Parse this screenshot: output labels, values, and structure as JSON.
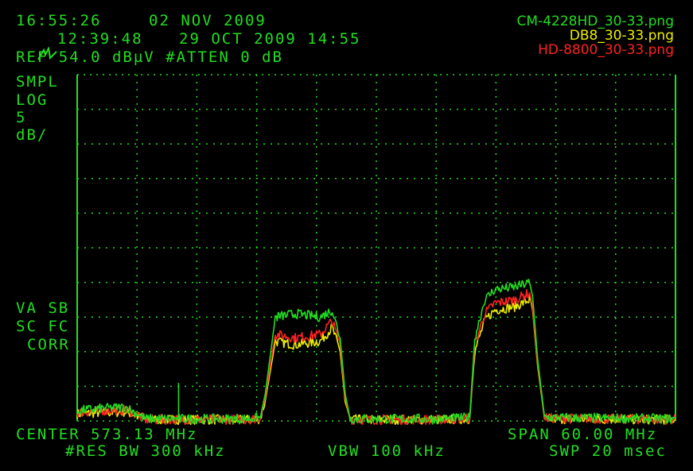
{
  "header": {
    "time": "16:55:26",
    "date": "02 NOV 2009",
    "saved_time": "12:39:48",
    "saved_date": "29 OCT 2009 14:55",
    "ref_line": "REF 54.0 dBµV #ATTEN 0 dB"
  },
  "left_labels": {
    "mode": "SMPL",
    "scale": "LOG",
    "div": "5",
    "unit": "dB/",
    "va_sb": "VA SB",
    "sc_fc": "SC FC",
    "corr": "CORR"
  },
  "footer": {
    "center": "CENTER 573.13 MHz",
    "span": "SPAN 60.00 MHz",
    "res_bw": "#RES BW 300 kHz",
    "vbw": "VBW 100 kHz",
    "swp": "SWP 20 msec"
  },
  "legend": [
    {
      "name": "CM-4228HD_30-33.png",
      "color": "#22dd22"
    },
    {
      "name": "DB8_30-33.png",
      "color": "#eeee00"
    },
    {
      "name": "HD-8800_30-33.png",
      "color": "#ff2222"
    }
  ],
  "chart_data": {
    "type": "line",
    "x_unit": "MHz",
    "y_unit": "dBµV",
    "xlim": [
      543.13,
      603.13
    ],
    "ylim": [
      4.0,
      54.0
    ],
    "grid": true,
    "series": [
      {
        "name": "CM-4228HD_30-33.png",
        "color": "#22dd22",
        "x": [
          543.13,
          545.5,
          548.0,
          549.0,
          550.0,
          560.0,
          561.5,
          562.0,
          563.0,
          565.0,
          567.5,
          568.7,
          569.5,
          570.0,
          570.5,
          580.0,
          582.5,
          583.0,
          584.0,
          585.0,
          587.0,
          588.5,
          588.8,
          589.3,
          590.0,
          603.13
        ],
        "y": [
          5.5,
          5.8,
          6.0,
          5.2,
          4.3,
          4.3,
          4.5,
          8.0,
          19.0,
          19.5,
          19.0,
          20.0,
          16.0,
          8.0,
          4.3,
          4.3,
          4.5,
          16.0,
          21.5,
          23.0,
          23.3,
          24.0,
          22.0,
          13.0,
          4.5,
          4.3
        ]
      },
      {
        "name": "DB8_30-33.png",
        "color": "#eeee00",
        "x": [
          543.13,
          545.5,
          548.0,
          549.0,
          550.0,
          560.0,
          561.5,
          562.0,
          563.0,
          565.0,
          567.5,
          568.7,
          569.5,
          570.0,
          570.5,
          580.0,
          582.5,
          583.0,
          584.0,
          585.0,
          587.0,
          588.5,
          588.8,
          589.3,
          590.0,
          603.13
        ],
        "y": [
          5.0,
          5.2,
          5.3,
          4.8,
          4.2,
          4.2,
          4.3,
          7.0,
          15.5,
          15.0,
          15.5,
          17.5,
          14.0,
          7.0,
          4.2,
          4.2,
          4.3,
          14.0,
          18.5,
          20.0,
          20.5,
          21.5,
          20.0,
          12.0,
          4.3,
          4.2
        ]
      },
      {
        "name": "HD-8800_30-33.png",
        "color": "#ff2222",
        "x": [
          543.13,
          545.5,
          548.0,
          549.0,
          550.0,
          560.0,
          561.5,
          562.0,
          563.0,
          565.0,
          567.5,
          568.7,
          569.5,
          570.0,
          570.5,
          580.0,
          582.5,
          583.0,
          584.0,
          585.0,
          587.0,
          588.5,
          588.8,
          589.3,
          590.0,
          603.13
        ],
        "y": [
          5.2,
          5.5,
          5.6,
          5.0,
          4.2,
          4.2,
          4.4,
          7.5,
          16.5,
          16.0,
          16.5,
          18.5,
          15.0,
          7.5,
          4.2,
          4.2,
          4.4,
          15.0,
          19.5,
          21.0,
          21.5,
          22.5,
          20.5,
          12.5,
          4.4,
          4.2
        ]
      }
    ]
  }
}
